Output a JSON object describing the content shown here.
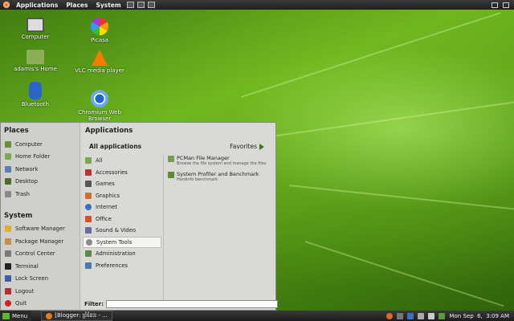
{
  "top_panel": {
    "menus": [
      "Applications",
      "Places",
      "System"
    ]
  },
  "desktop_icons": [
    {
      "label": "Computer",
      "icon": "computer-icon"
    },
    {
      "label": "adamis's Home",
      "icon": "home-folder-icon"
    },
    {
      "label": "Bluetooth",
      "icon": "bluetooth-icon"
    },
    {
      "label": "Picasa",
      "icon": "picasa-icon"
    },
    {
      "label": "VLC media player",
      "icon": "vlc-icon"
    },
    {
      "label": "Chromium Web Browser",
      "icon": "chromium-icon"
    }
  ],
  "menu": {
    "places_title": "Places",
    "places": [
      {
        "label": "Computer",
        "icon": "computer-icon"
      },
      {
        "label": "Home Folder",
        "icon": "home-folder-icon"
      },
      {
        "label": "Network",
        "icon": "network-icon"
      },
      {
        "label": "Desktop",
        "icon": "desktop-icon"
      },
      {
        "label": "Trash",
        "icon": "trash-icon"
      }
    ],
    "system_title": "System",
    "system": [
      {
        "label": "Software Manager",
        "icon": "software-manager-icon"
      },
      {
        "label": "Package Manager",
        "icon": "package-manager-icon"
      },
      {
        "label": "Control Center",
        "icon": "control-center-icon"
      },
      {
        "label": "Terminal",
        "icon": "terminal-icon"
      },
      {
        "label": "Lock Screen",
        "icon": "lock-icon"
      },
      {
        "label": "Logout",
        "icon": "logout-icon"
      },
      {
        "label": "Quit",
        "icon": "quit-icon"
      }
    ],
    "applications_title": "Applications",
    "all_applications": "All applications",
    "favorites": "Favorites",
    "categories": [
      {
        "label": "All",
        "icon": "all-icon"
      },
      {
        "label": "Accessories",
        "icon": "accessories-icon"
      },
      {
        "label": "Games",
        "icon": "games-icon"
      },
      {
        "label": "Graphics",
        "icon": "graphics-icon"
      },
      {
        "label": "Internet",
        "icon": "internet-icon"
      },
      {
        "label": "Office",
        "icon": "office-icon"
      },
      {
        "label": "Sound & Video",
        "icon": "sound-video-icon"
      },
      {
        "label": "System Tools",
        "icon": "system-tools-icon"
      },
      {
        "label": "Administration",
        "icon": "administration-icon"
      },
      {
        "label": "Preferences",
        "icon": "preferences-icon"
      }
    ],
    "selected_category": "System Tools",
    "apps": [
      {
        "name": "PCMan File Manager",
        "desc": "Browse the file system and manage the files",
        "icon": "file-manager-icon"
      },
      {
        "name": "System Profiler and Benchmark",
        "desc": "Hardinfo benchmark",
        "icon": "profiler-icon"
      }
    ],
    "filter_label": "Filter:",
    "filter_value": ""
  },
  "bottom_panel": {
    "menu_label": "Menu",
    "task_label": "[Blogger: ព្រំដែន - ...",
    "clock": "Mon Sep  6,  3:09 AM"
  },
  "colors": {
    "desktop_green": "#6bb31e",
    "panel_dark": "#2a2a2a",
    "menu_bg": "#d9d9d6"
  }
}
